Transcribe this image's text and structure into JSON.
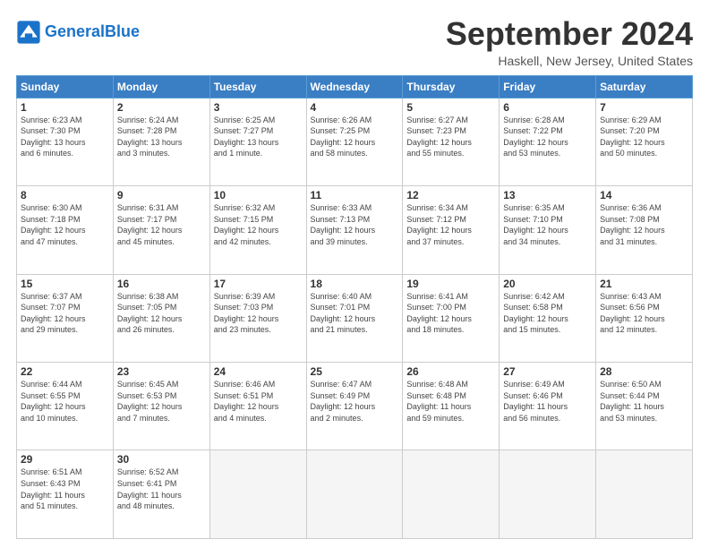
{
  "header": {
    "logo_line1": "General",
    "logo_line2": "Blue",
    "month_title": "September 2024",
    "location": "Haskell, New Jersey, United States"
  },
  "weekdays": [
    "Sunday",
    "Monday",
    "Tuesday",
    "Wednesday",
    "Thursday",
    "Friday",
    "Saturday"
  ],
  "weeks": [
    [
      {
        "day": "1",
        "info": "Sunrise: 6:23 AM\nSunset: 7:30 PM\nDaylight: 13 hours\nand 6 minutes."
      },
      {
        "day": "2",
        "info": "Sunrise: 6:24 AM\nSunset: 7:28 PM\nDaylight: 13 hours\nand 3 minutes."
      },
      {
        "day": "3",
        "info": "Sunrise: 6:25 AM\nSunset: 7:27 PM\nDaylight: 13 hours\nand 1 minute."
      },
      {
        "day": "4",
        "info": "Sunrise: 6:26 AM\nSunset: 7:25 PM\nDaylight: 12 hours\nand 58 minutes."
      },
      {
        "day": "5",
        "info": "Sunrise: 6:27 AM\nSunset: 7:23 PM\nDaylight: 12 hours\nand 55 minutes."
      },
      {
        "day": "6",
        "info": "Sunrise: 6:28 AM\nSunset: 7:22 PM\nDaylight: 12 hours\nand 53 minutes."
      },
      {
        "day": "7",
        "info": "Sunrise: 6:29 AM\nSunset: 7:20 PM\nDaylight: 12 hours\nand 50 minutes."
      }
    ],
    [
      {
        "day": "8",
        "info": "Sunrise: 6:30 AM\nSunset: 7:18 PM\nDaylight: 12 hours\nand 47 minutes."
      },
      {
        "day": "9",
        "info": "Sunrise: 6:31 AM\nSunset: 7:17 PM\nDaylight: 12 hours\nand 45 minutes."
      },
      {
        "day": "10",
        "info": "Sunrise: 6:32 AM\nSunset: 7:15 PM\nDaylight: 12 hours\nand 42 minutes."
      },
      {
        "day": "11",
        "info": "Sunrise: 6:33 AM\nSunset: 7:13 PM\nDaylight: 12 hours\nand 39 minutes."
      },
      {
        "day": "12",
        "info": "Sunrise: 6:34 AM\nSunset: 7:12 PM\nDaylight: 12 hours\nand 37 minutes."
      },
      {
        "day": "13",
        "info": "Sunrise: 6:35 AM\nSunset: 7:10 PM\nDaylight: 12 hours\nand 34 minutes."
      },
      {
        "day": "14",
        "info": "Sunrise: 6:36 AM\nSunset: 7:08 PM\nDaylight: 12 hours\nand 31 minutes."
      }
    ],
    [
      {
        "day": "15",
        "info": "Sunrise: 6:37 AM\nSunset: 7:07 PM\nDaylight: 12 hours\nand 29 minutes."
      },
      {
        "day": "16",
        "info": "Sunrise: 6:38 AM\nSunset: 7:05 PM\nDaylight: 12 hours\nand 26 minutes."
      },
      {
        "day": "17",
        "info": "Sunrise: 6:39 AM\nSunset: 7:03 PM\nDaylight: 12 hours\nand 23 minutes."
      },
      {
        "day": "18",
        "info": "Sunrise: 6:40 AM\nSunset: 7:01 PM\nDaylight: 12 hours\nand 21 minutes."
      },
      {
        "day": "19",
        "info": "Sunrise: 6:41 AM\nSunset: 7:00 PM\nDaylight: 12 hours\nand 18 minutes."
      },
      {
        "day": "20",
        "info": "Sunrise: 6:42 AM\nSunset: 6:58 PM\nDaylight: 12 hours\nand 15 minutes."
      },
      {
        "day": "21",
        "info": "Sunrise: 6:43 AM\nSunset: 6:56 PM\nDaylight: 12 hours\nand 12 minutes."
      }
    ],
    [
      {
        "day": "22",
        "info": "Sunrise: 6:44 AM\nSunset: 6:55 PM\nDaylight: 12 hours\nand 10 minutes."
      },
      {
        "day": "23",
        "info": "Sunrise: 6:45 AM\nSunset: 6:53 PM\nDaylight: 12 hours\nand 7 minutes."
      },
      {
        "day": "24",
        "info": "Sunrise: 6:46 AM\nSunset: 6:51 PM\nDaylight: 12 hours\nand 4 minutes."
      },
      {
        "day": "25",
        "info": "Sunrise: 6:47 AM\nSunset: 6:49 PM\nDaylight: 12 hours\nand 2 minutes."
      },
      {
        "day": "26",
        "info": "Sunrise: 6:48 AM\nSunset: 6:48 PM\nDaylight: 11 hours\nand 59 minutes."
      },
      {
        "day": "27",
        "info": "Sunrise: 6:49 AM\nSunset: 6:46 PM\nDaylight: 11 hours\nand 56 minutes."
      },
      {
        "day": "28",
        "info": "Sunrise: 6:50 AM\nSunset: 6:44 PM\nDaylight: 11 hours\nand 53 minutes."
      }
    ],
    [
      {
        "day": "29",
        "info": "Sunrise: 6:51 AM\nSunset: 6:43 PM\nDaylight: 11 hours\nand 51 minutes."
      },
      {
        "day": "30",
        "info": "Sunrise: 6:52 AM\nSunset: 6:41 PM\nDaylight: 11 hours\nand 48 minutes."
      },
      {
        "day": "",
        "info": ""
      },
      {
        "day": "",
        "info": ""
      },
      {
        "day": "",
        "info": ""
      },
      {
        "day": "",
        "info": ""
      },
      {
        "day": "",
        "info": ""
      }
    ]
  ]
}
